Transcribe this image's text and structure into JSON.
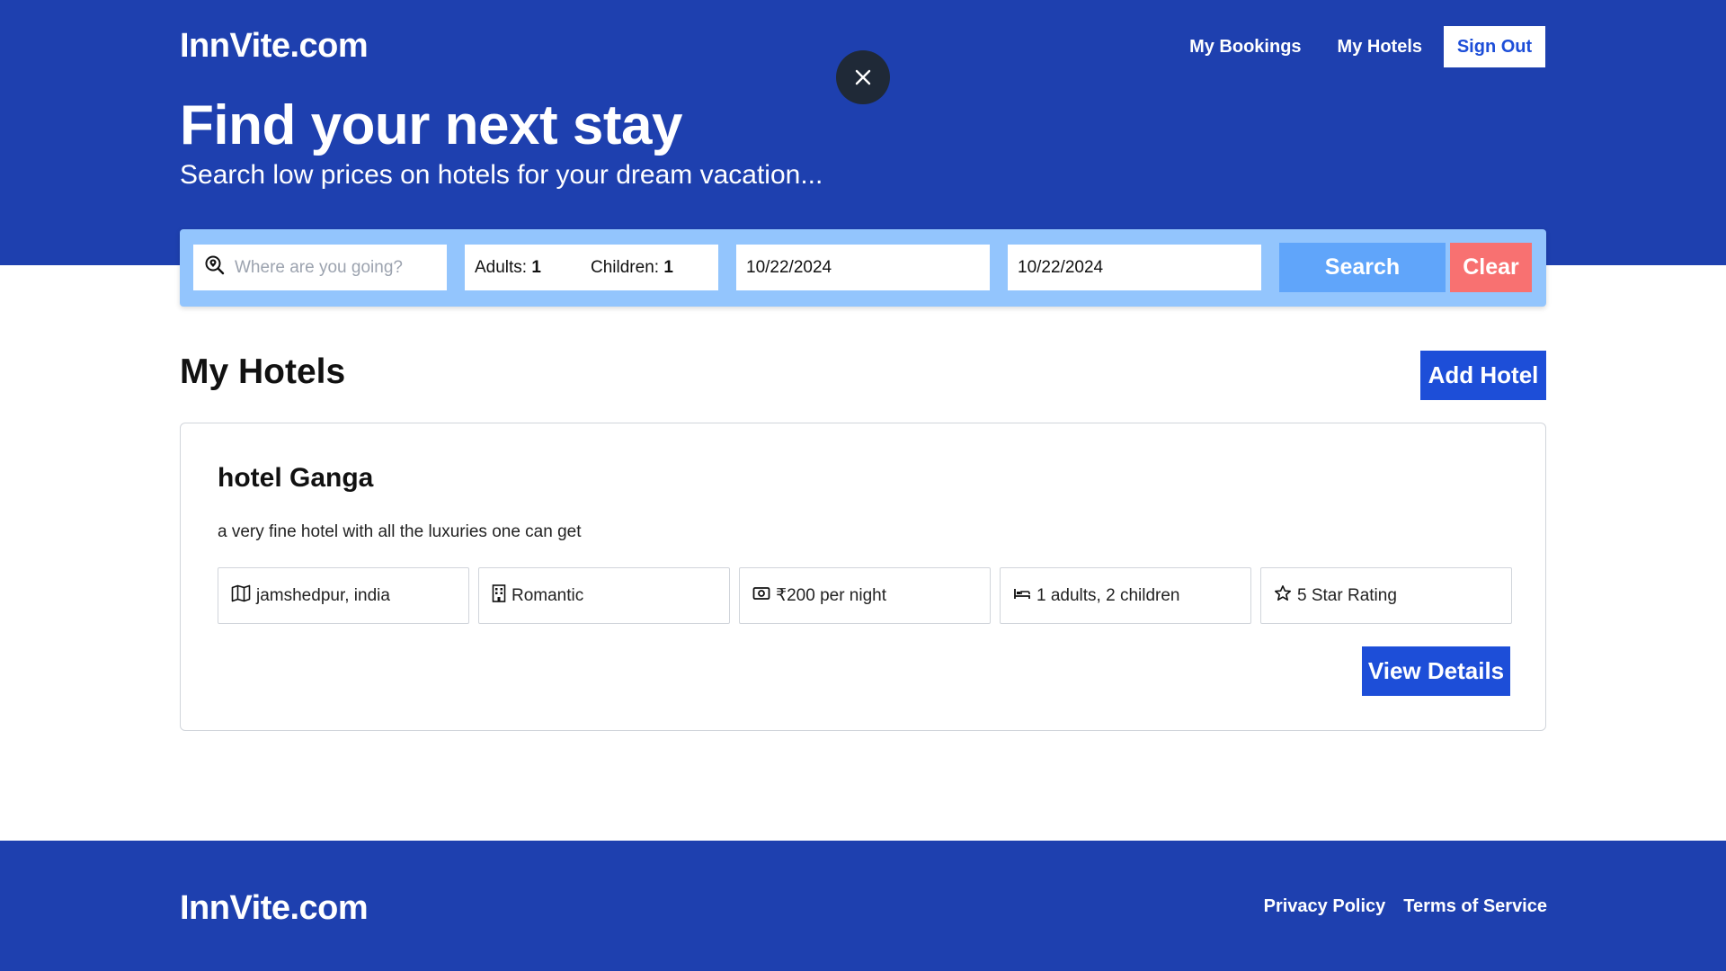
{
  "header": {
    "brand": "InnVite.com",
    "nav": {
      "bookings": "My Bookings",
      "hotels": "My Hotels",
      "sign_out": "Sign Out"
    }
  },
  "hero": {
    "title": "Find your next stay",
    "subtitle": "Search low prices on hotels for your dream vacation..."
  },
  "search": {
    "destination_placeholder": "Where are you going?",
    "adults_label": "Adults:",
    "adults_value": "1",
    "children_label": "Children:",
    "children_value": "1",
    "check_in": "10/22/2024",
    "check_out": "10/22/2024",
    "search_label": "Search",
    "clear_label": "Clear"
  },
  "main": {
    "title": "My Hotels",
    "add_hotel_label": "Add Hotel",
    "hotels": [
      {
        "name": "hotel Ganga",
        "description": "a very fine hotel with all the luxuries one can get",
        "location": "jamshedpur, india",
        "type": "Romantic",
        "price": "₹200 per night",
        "guests": "1 adults, 2 children",
        "rating": "5 Star Rating",
        "view_label": "View Details"
      }
    ]
  },
  "footer": {
    "brand": "InnVite.com",
    "privacy": "Privacy Policy",
    "terms": "Terms of Service"
  },
  "colors": {
    "primary": "#1e40af",
    "button_blue": "#1d4ed8",
    "search_bar": "#93c5fd",
    "search_button": "#60a5fa",
    "clear_button": "#f87171",
    "close_button": "#1f2937"
  },
  "icons": {
    "destination": "search-location-icon",
    "close": "close-icon",
    "location": "map-icon",
    "type": "building-icon",
    "price": "money-icon",
    "guests": "bed-icon",
    "rating": "star-icon"
  }
}
